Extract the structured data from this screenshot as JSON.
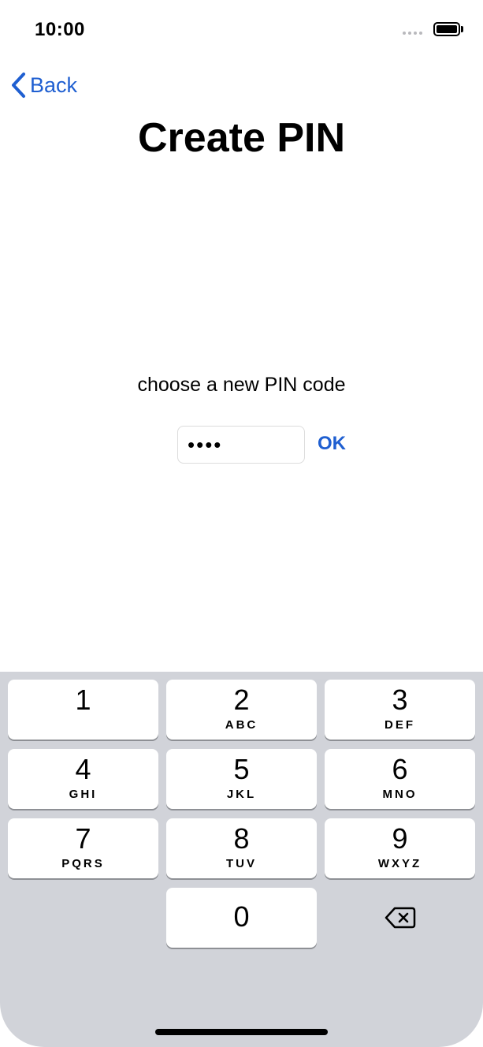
{
  "status_bar": {
    "time": "10:00",
    "signal_icon": "signal-dots-icon",
    "battery_icon": "battery-icon"
  },
  "navigation": {
    "back_label": "Back",
    "back_icon": "chevron-left-icon"
  },
  "page": {
    "title": "Create PIN",
    "prompt": "choose a new PIN code",
    "pin_value": "••••",
    "ok_label": "OK"
  },
  "keyboard": {
    "keys": [
      {
        "digit": "1",
        "letters": ""
      },
      {
        "digit": "2",
        "letters": "ABC"
      },
      {
        "digit": "3",
        "letters": "DEF"
      },
      {
        "digit": "4",
        "letters": "GHI"
      },
      {
        "digit": "5",
        "letters": "JKL"
      },
      {
        "digit": "6",
        "letters": "MNO"
      },
      {
        "digit": "7",
        "letters": "PQRS"
      },
      {
        "digit": "8",
        "letters": "TUV"
      },
      {
        "digit": "9",
        "letters": "WXYZ"
      },
      {
        "digit": "0",
        "letters": ""
      }
    ],
    "delete_icon": "backspace-icon"
  },
  "colors": {
    "accent": "#1f5fd1",
    "keyboard_bg": "#d1d3d9",
    "key_bg": "#ffffff"
  }
}
